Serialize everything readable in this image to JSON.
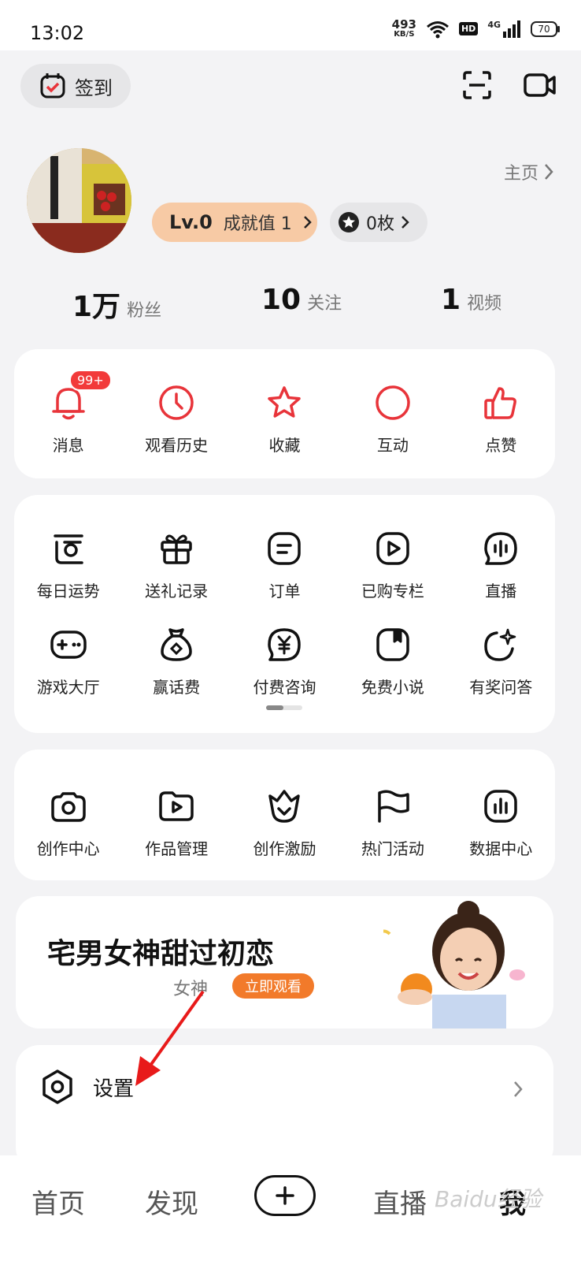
{
  "status_bar": {
    "time": "13:02",
    "net_speed": "493",
    "net_unit": "KB/S",
    "hd": "HD",
    "signal": "4G",
    "battery": "70"
  },
  "header": {
    "checkin_label": "签到",
    "icons": [
      "scan-icon",
      "video-camera-icon"
    ]
  },
  "profile": {
    "homepage_label": "主页",
    "level": "Lv.0",
    "achievement": "成就值 1",
    "coins": "0枚"
  },
  "stats": [
    {
      "num": "1万",
      "label": "粉丝"
    },
    {
      "num": "10",
      "label": "关注"
    },
    {
      "num": "1",
      "label": "视频"
    }
  ],
  "quick": {
    "badge": "99+",
    "items": [
      "消息",
      "观看历史",
      "收藏",
      "互动",
      "点赞"
    ]
  },
  "services": {
    "row1": [
      "每日运势",
      "送礼记录",
      "订单",
      "已购专栏",
      "直播"
    ],
    "row2": [
      "游戏大厅",
      "赢话费",
      "付费咨询",
      "免费小说",
      "有奖问答"
    ]
  },
  "creator": {
    "items": [
      "创作中心",
      "作品管理",
      "创作激励",
      "热门活动",
      "数据中心"
    ]
  },
  "banner": {
    "title": "宅男女神甜过初恋",
    "tag": "女神",
    "button": "立即观看"
  },
  "settings": {
    "label": "设置"
  },
  "tabbar": {
    "items": [
      "首页",
      "发现",
      "直播",
      "我"
    ],
    "active": "我"
  },
  "watermark": "Baidu经验",
  "colors": {
    "accent_red": "#e8343a",
    "level_pill": "#f7caa5",
    "banner_button": "#f27a2a"
  }
}
